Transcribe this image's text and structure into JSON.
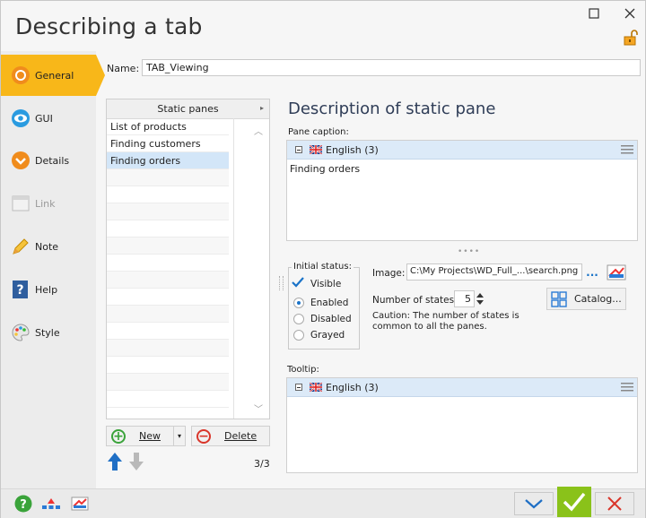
{
  "window": {
    "title": "Describing a tab",
    "maximize_icon": "maximize-icon",
    "close_icon": "close-icon"
  },
  "sidebar": {
    "items": [
      {
        "label": "General",
        "icon": "general-icon"
      },
      {
        "label": "GUI",
        "icon": "gui-icon"
      },
      {
        "label": "Details",
        "icon": "details-icon"
      },
      {
        "label": "Link",
        "icon": "link-icon"
      },
      {
        "label": "Note",
        "icon": "note-icon"
      },
      {
        "label": "Help",
        "icon": "help-icon"
      },
      {
        "label": "Style",
        "icon": "style-icon"
      }
    ]
  },
  "name": {
    "label": "Name:",
    "value": "TAB_Viewing"
  },
  "static_panes": {
    "header": "Static panes",
    "rows": [
      "List of products",
      "Finding customers",
      "Finding orders"
    ],
    "selected": "Finding orders",
    "new_label": "New",
    "delete_label": "Delete",
    "counter": "3/3"
  },
  "description": {
    "title": "Description of static pane",
    "caption_label": "Pane caption:",
    "caption_lang": "English (3)",
    "caption_value": "Finding orders",
    "status_legend": "Initial status:",
    "visible_label": "Visible",
    "enabled_label": "Enabled",
    "disabled_label": "Disabled",
    "grayed_label": "Grayed",
    "image_label": "Image:",
    "image_value": "C:\\My Projects\\WD_Full_...\\search.png",
    "image_browse": "...",
    "states_label": "Number of states:",
    "states_value": "5",
    "catalog_label": "Catalog...",
    "caution": "Caution: The number of states is common to all the panes.",
    "tooltip_label": "Tooltip:",
    "tooltip_lang": "English (3)"
  },
  "colors": {
    "accent": "#f8b719",
    "selection": "#d3e6f8",
    "ok_green": "#8ac21a",
    "cancel_red": "#d9352a",
    "link_blue": "#1a73c8"
  }
}
